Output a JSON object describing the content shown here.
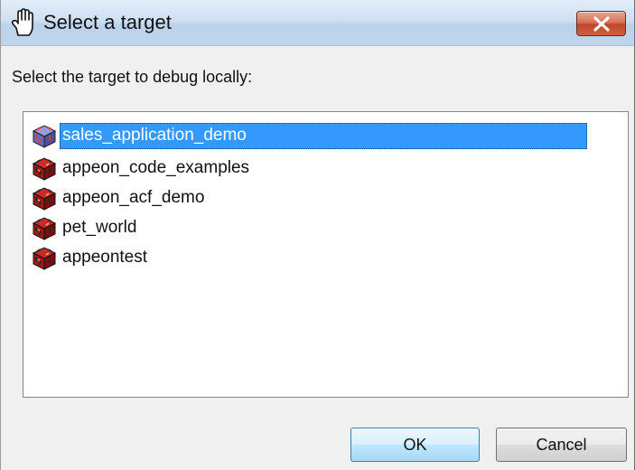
{
  "window": {
    "title": "Select a target",
    "close_icon": "close-x-icon",
    "title_icon": "hand-pointer-icon"
  },
  "prompt": "Select the target to debug locally:",
  "targets": [
    {
      "label": "sales_application_demo",
      "selected": true,
      "icon": "target-cube-icon"
    },
    {
      "label": "appeon_code_examples",
      "selected": false,
      "icon": "target-cube-icon"
    },
    {
      "label": "appeon_acf_demo",
      "selected": false,
      "icon": "target-cube-icon"
    },
    {
      "label": "pet_world",
      "selected": false,
      "icon": "target-cube-icon"
    },
    {
      "label": "appeontest",
      "selected": false,
      "icon": "target-cube-icon"
    }
  ],
  "buttons": {
    "ok": "OK",
    "cancel": "Cancel"
  },
  "colors": {
    "selection": "#3399ff",
    "close_button": "#c0462a",
    "title_bar": "#cfe0f2"
  }
}
